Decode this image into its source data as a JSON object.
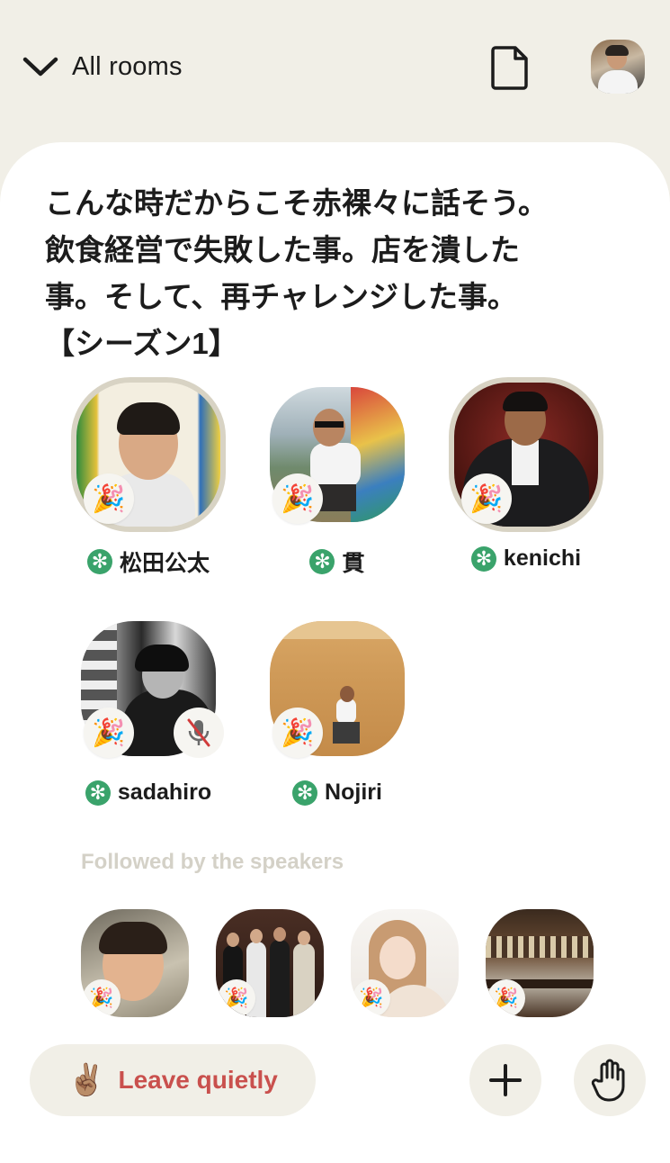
{
  "header": {
    "back_label": "All rooms",
    "back_icon": "chevron-down-icon",
    "doc_icon": "document-icon",
    "profile_icon": "avatar"
  },
  "room": {
    "title": "こんな時だからこそ赤裸々に話そう。\n飲食経営で失敗した事。店を潰した\n事。そして、再チャレンジした事。\n【シーズン1】"
  },
  "speakers": [
    {
      "name": "松田公太",
      "badge": "🎉",
      "moderator": true,
      "speaking": true,
      "muted": false
    },
    {
      "name": "貫",
      "badge": "🎉",
      "moderator": true,
      "speaking": false,
      "muted": false
    },
    {
      "name": "kenichi",
      "badge": "🎉",
      "moderator": true,
      "speaking": true,
      "muted": false
    },
    {
      "name": "sadahiro",
      "badge": "🎉",
      "moderator": true,
      "speaking": false,
      "muted": true
    },
    {
      "name": "Nojiri",
      "badge": "🎉",
      "moderator": true,
      "speaking": false,
      "muted": false
    }
  ],
  "moderator_symbol": "✻",
  "followed_section": {
    "label": "Followed by the speakers",
    "listeners": [
      {
        "badge": "🎉"
      },
      {
        "badge": "🎉"
      },
      {
        "badge": "🎉"
      },
      {
        "badge": "🎉"
      }
    ]
  },
  "actions": {
    "leave_emoji": "✌🏽",
    "leave_label": "Leave quietly",
    "add_icon": "plus-icon",
    "raise_hand_icon": "raise-hand-icon"
  },
  "colors": {
    "background": "#f1efe7",
    "sheet": "#ffffff",
    "moderator_green": "#3aa36b",
    "leave_red": "#c9504d",
    "section_label": "#d4d1c7"
  }
}
